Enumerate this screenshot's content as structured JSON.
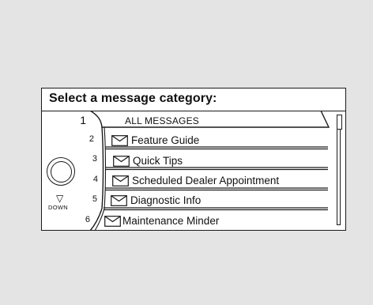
{
  "screen": {
    "heading": "Select  a  message category:",
    "items": [
      {
        "number": "1",
        "label": "ALL MESSAGES",
        "icon": "",
        "selected": true
      },
      {
        "number": "2",
        "label": "Feature Guide",
        "icon": "envelope-icon",
        "selected": false
      },
      {
        "number": "3",
        "label": "Quick  Tips",
        "icon": "envelope-icon",
        "selected": false
      },
      {
        "number": "4",
        "label": "Scheduled Dealer Appointment",
        "icon": "envelope-icon",
        "selected": false
      },
      {
        "number": "5",
        "label": "Diagnostic Info",
        "icon": "envelope-icon",
        "selected": false
      },
      {
        "number": "6",
        "label": "Maintenance Minder",
        "icon": "envelope-icon",
        "selected": false
      }
    ],
    "down_arrow": "▽",
    "down_label": "DOWN"
  },
  "colors": {
    "background": "#e4e4e4",
    "screen": "#ffffff",
    "line": "#1a1a1a"
  }
}
